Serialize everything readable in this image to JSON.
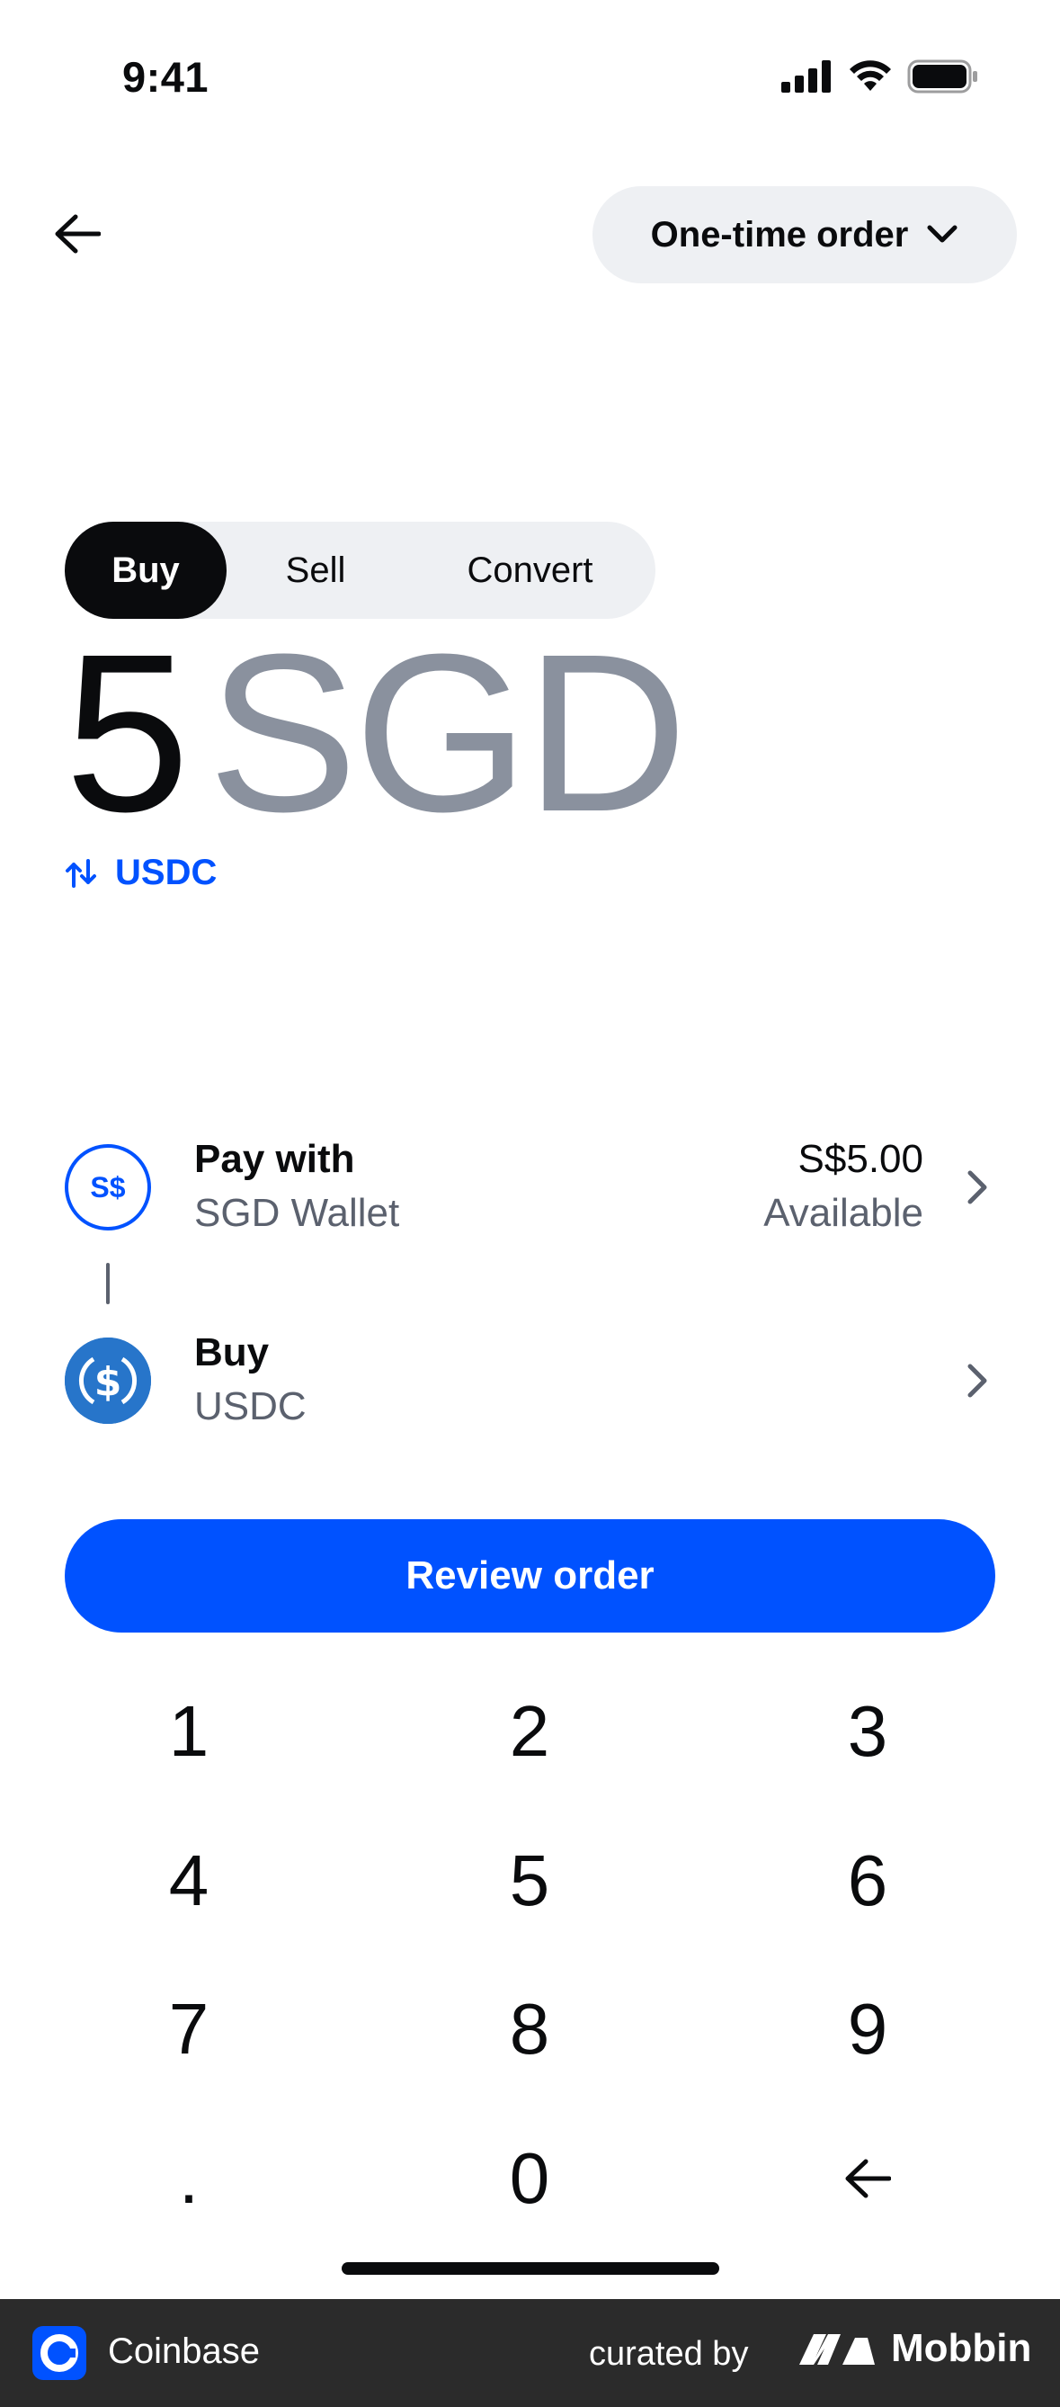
{
  "status_bar": {
    "time": "9:41"
  },
  "header": {
    "order_type_label": "One-time order"
  },
  "tabs": [
    {
      "label": "Buy",
      "active": true
    },
    {
      "label": "Sell",
      "active": false
    },
    {
      "label": "Convert",
      "active": false
    }
  ],
  "amount": {
    "value": "5",
    "currency": "SGD"
  },
  "swap": {
    "label": "USDC"
  },
  "pay_with": {
    "icon_text": "S$",
    "title": "Pay with",
    "subtitle": "SGD Wallet",
    "balance": "S$5.00",
    "balance_label": "Available"
  },
  "buy_asset": {
    "title": "Buy",
    "subtitle": "USDC"
  },
  "review_button": {
    "label": "Review order"
  },
  "keypad": {
    "keys": [
      "1",
      "2",
      "3",
      "4",
      "5",
      "6",
      "7",
      "8",
      "9",
      ".",
      "0"
    ]
  },
  "footer": {
    "app_name": "Coinbase",
    "curated_by": "curated by",
    "brand": "Mobbin"
  },
  "colors": {
    "accent": "#0052ff",
    "text_primary": "#0a0b0d",
    "text_secondary": "#5b616e",
    "muted_amount": "#8a919e",
    "chip_bg": "#eef0f3",
    "usdc_blue": "#2775ca"
  }
}
